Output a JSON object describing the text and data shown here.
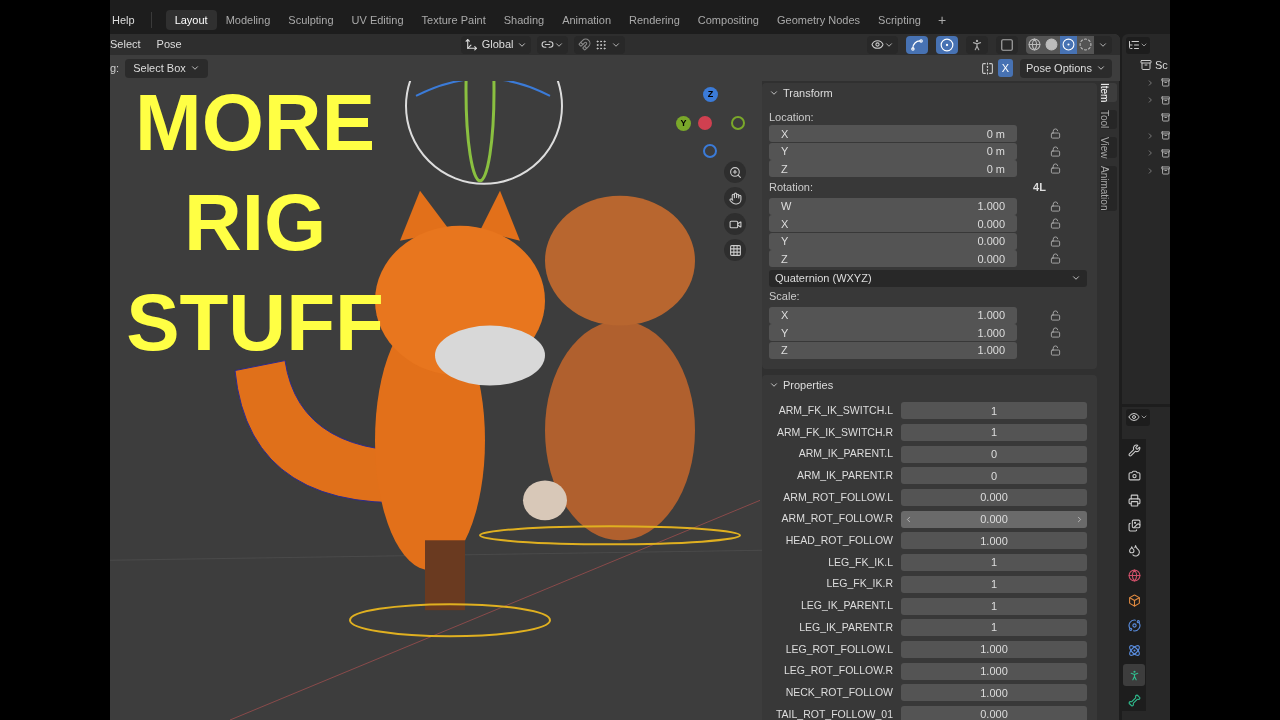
{
  "top_bar": {
    "menus": [
      "Help"
    ],
    "workspace_tabs": [
      {
        "label": "Layout",
        "selected": true
      },
      {
        "label": "Modeling",
        "selected": false
      },
      {
        "label": "Sculpting",
        "selected": false
      },
      {
        "label": "UV Editing",
        "selected": false
      },
      {
        "label": "Texture Paint",
        "selected": false
      },
      {
        "label": "Shading",
        "selected": false
      },
      {
        "label": "Animation",
        "selected": false
      },
      {
        "label": "Rendering",
        "selected": false
      },
      {
        "label": "Compositing",
        "selected": false
      },
      {
        "label": "Geometry Nodes",
        "selected": false
      },
      {
        "label": "Scripting",
        "selected": false
      }
    ],
    "add_tab": "+"
  },
  "viewport_header": {
    "menus": [
      "Select",
      "Pose"
    ],
    "orientation": "Global",
    "toggles": [
      {
        "kind": "gizmo",
        "on": true
      },
      {
        "kind": "overlay",
        "on": true
      },
      {
        "kind": "bone",
        "on": false
      },
      {
        "kind": "xray",
        "on": false
      }
    ],
    "shading": [
      {
        "kind": "wireframe",
        "selected": false
      },
      {
        "kind": "solid",
        "selected": false
      },
      {
        "kind": "material",
        "selected": true
      },
      {
        "kind": "rendered",
        "selected": false
      }
    ]
  },
  "tool_settings": {
    "drag_label": "g:",
    "tool": "Select Box",
    "mirror": {
      "label": "X",
      "on": true
    },
    "pose_options": "Pose Options"
  },
  "overlay_text": [
    "MORE",
    "RIG",
    "STUFF"
  ],
  "gizmo_axes": [
    {
      "label": "Z",
      "color": "#3b7bd8"
    },
    {
      "label": "Y",
      "color": "#7aa82a"
    }
  ],
  "sidebar": {
    "tabs": [
      {
        "label": "Item",
        "selected": true
      },
      {
        "label": "Tool",
        "selected": false
      },
      {
        "label": "View",
        "selected": false
      },
      {
        "label": "Animation",
        "selected": false
      }
    ],
    "transform": {
      "title": "Transform",
      "expanded": true,
      "location_label": "Location:",
      "location": [
        {
          "axis": "X",
          "value": "0 m"
        },
        {
          "axis": "Y",
          "value": "0 m"
        },
        {
          "axis": "Z",
          "value": "0 m"
        }
      ],
      "rotation_label": "Rotation:",
      "rotation_lock": "4L",
      "rotation": [
        {
          "axis": "W",
          "value": "1.000"
        },
        {
          "axis": "X",
          "value": "0.000"
        },
        {
          "axis": "Y",
          "value": "0.000"
        },
        {
          "axis": "Z",
          "value": "0.000"
        }
      ],
      "rotation_mode": "Quaternion (WXYZ)",
      "scale_label": "Scale:",
      "scale": [
        {
          "axis": "X",
          "value": "1.000"
        },
        {
          "axis": "Y",
          "value": "1.000"
        },
        {
          "axis": "Z",
          "value": "1.000"
        }
      ]
    },
    "properties": {
      "title": "Properties",
      "expanded": true,
      "rows": [
        {
          "name": "ARM_FK_IK_SWITCH.L",
          "value": "1",
          "hovered": false
        },
        {
          "name": "ARM_FK_IK_SWITCH.R",
          "value": "1",
          "hovered": false
        },
        {
          "name": "ARM_IK_PARENT.L",
          "value": "0",
          "hovered": false
        },
        {
          "name": "ARM_IK_PARENT.R",
          "value": "0",
          "hovered": false
        },
        {
          "name": "ARM_ROT_FOLLOW.L",
          "value": "0.000",
          "hovered": false
        },
        {
          "name": "ARM_ROT_FOLLOW.R",
          "value": "0.000",
          "hovered": true
        },
        {
          "name": "HEAD_ROT_FOLLOW",
          "value": "1.000",
          "hovered": false
        },
        {
          "name": "LEG_FK_IK.L",
          "value": "1",
          "hovered": false
        },
        {
          "name": "LEG_FK_IK.R",
          "value": "1",
          "hovered": false
        },
        {
          "name": "LEG_IK_PARENT.L",
          "value": "1",
          "hovered": false
        },
        {
          "name": "LEG_IK_PARENT.R",
          "value": "1",
          "hovered": false
        },
        {
          "name": "LEG_ROT_FOLLOW.L",
          "value": "1.000",
          "hovered": false
        },
        {
          "name": "LEG_ROT_FOLLOW.R",
          "value": "1.000",
          "hovered": false
        },
        {
          "name": "NECK_ROT_FOLLOW",
          "value": "1.000",
          "hovered": false
        },
        {
          "name": "TAIL_ROT_FOLLOW_01",
          "value": "0.000",
          "hovered": false
        }
      ]
    }
  },
  "outliner": {
    "scene_label": "Sc",
    "rows": [
      {
        "expandable": true
      },
      {
        "expandable": true
      },
      {
        "expandable": false
      },
      {
        "expandable": true
      },
      {
        "expandable": true
      },
      {
        "expandable": true
      }
    ]
  },
  "properties_editor": {
    "tabs": [
      {
        "kind": "tool",
        "selected": false
      },
      {
        "kind": "render",
        "selected": false
      },
      {
        "kind": "output",
        "selected": false
      },
      {
        "kind": "view_layer",
        "selected": false
      },
      {
        "kind": "scene",
        "selected": false
      },
      {
        "kind": "world",
        "selected": false
      },
      {
        "kind": "object",
        "selected": false
      },
      {
        "kind": "physics",
        "selected": false
      },
      {
        "kind": "constraints",
        "selected": false
      },
      {
        "kind": "data",
        "selected": true
      },
      {
        "kind": "bone",
        "selected": false
      }
    ]
  }
}
